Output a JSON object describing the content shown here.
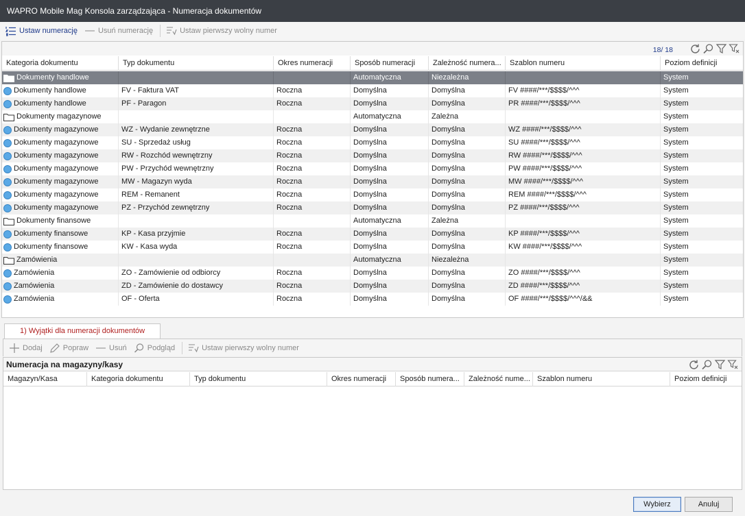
{
  "window": {
    "title": "WAPRO Mobile Mag Konsola zarządzająca - Numeracja dokumentów"
  },
  "toolbar": {
    "set_numbering": "Ustaw numerację",
    "remove_numbering": "Usuń numerację",
    "set_first_free": "Ustaw pierwszy wolny numer"
  },
  "grid": {
    "counter": "18/ 18",
    "columns": [
      "Kategoria dokumentu",
      "Typ dokumentu",
      "Okres numeracji",
      "Sposób numeracji",
      "Zależność numera...",
      "Szablon numeru",
      "Poziom definicji"
    ],
    "rows": [
      {
        "icon": "folder",
        "cat": "Dokumenty handlowe",
        "type": "",
        "period": "",
        "method": "Automatyczna",
        "dep": "Niezależna",
        "tpl": "",
        "level": "System"
      },
      {
        "icon": "dot",
        "cat": "Dokumenty handlowe",
        "type": "FV - Faktura VAT",
        "period": "Roczna",
        "method": "Domyślna",
        "dep": "Domyślna",
        "tpl": "FV ####/***/$$$$/^^^",
        "level": "System"
      },
      {
        "icon": "dot",
        "cat": "Dokumenty handlowe",
        "type": "PF - Paragon",
        "period": "Roczna",
        "method": "Domyślna",
        "dep": "Domyślna",
        "tpl": "PR ####/***/$$$$/^^^",
        "level": "System"
      },
      {
        "icon": "folder",
        "cat": "Dokumenty magazynowe",
        "type": "",
        "period": "",
        "method": "Automatyczna",
        "dep": "Zależna",
        "tpl": "",
        "level": "System"
      },
      {
        "icon": "dot",
        "cat": "Dokumenty magazynowe",
        "type": "WZ - Wydanie zewnętrzne",
        "period": "Roczna",
        "method": "Domyślna",
        "dep": "Domyślna",
        "tpl": "WZ ####/***/$$$$/^^^",
        "level": "System"
      },
      {
        "icon": "dot",
        "cat": "Dokumenty magazynowe",
        "type": "SU - Sprzedaż usług",
        "period": "Roczna",
        "method": "Domyślna",
        "dep": "Domyślna",
        "tpl": "SU ####/***/$$$$/^^^",
        "level": "System"
      },
      {
        "icon": "dot",
        "cat": "Dokumenty magazynowe",
        "type": "RW - Rozchód wewnętrzny",
        "period": "Roczna",
        "method": "Domyślna",
        "dep": "Domyślna",
        "tpl": "RW ####/***/$$$$/^^^",
        "level": "System"
      },
      {
        "icon": "dot",
        "cat": "Dokumenty magazynowe",
        "type": "PW - Przychód wewnętrzny",
        "period": "Roczna",
        "method": "Domyślna",
        "dep": "Domyślna",
        "tpl": "PW ####/***/$$$$/^^^",
        "level": "System"
      },
      {
        "icon": "dot",
        "cat": "Dokumenty magazynowe",
        "type": "MW - Magazyn wyda",
        "period": "Roczna",
        "method": "Domyślna",
        "dep": "Domyślna",
        "tpl": "MW ####/***/$$$$/^^^",
        "level": "System"
      },
      {
        "icon": "dot",
        "cat": "Dokumenty magazynowe",
        "type": "REM - Remanent",
        "period": "Roczna",
        "method": "Domyślna",
        "dep": "Domyślna",
        "tpl": "REM ####/***/$$$$/^^^",
        "level": "System"
      },
      {
        "icon": "dot",
        "cat": "Dokumenty magazynowe",
        "type": "PZ - Przychód zewnętrzny",
        "period": "Roczna",
        "method": "Domyślna",
        "dep": "Domyślna",
        "tpl": "PZ ####/***/$$$$/^^^",
        "level": "System"
      },
      {
        "icon": "folder",
        "cat": "Dokumenty finansowe",
        "type": "",
        "period": "",
        "method": "Automatyczna",
        "dep": "Zależna",
        "tpl": "",
        "level": "System"
      },
      {
        "icon": "dot",
        "cat": "Dokumenty finansowe",
        "type": "KP - Kasa przyjmie",
        "period": "Roczna",
        "method": "Domyślna",
        "dep": "Domyślna",
        "tpl": "KP ####/***/$$$$/^^^",
        "level": "System"
      },
      {
        "icon": "dot",
        "cat": "Dokumenty finansowe",
        "type": "KW - Kasa wyda",
        "period": "Roczna",
        "method": "Domyślna",
        "dep": "Domyślna",
        "tpl": "KW ####/***/$$$$/^^^",
        "level": "System"
      },
      {
        "icon": "folder",
        "cat": "Zamówienia",
        "type": "",
        "period": "",
        "method": "Automatyczna",
        "dep": "Niezależna",
        "tpl": "",
        "level": "System"
      },
      {
        "icon": "dot",
        "cat": "Zamówienia",
        "type": "ZO - Zamówienie od odbiorcy",
        "period": "Roczna",
        "method": "Domyślna",
        "dep": "Domyślna",
        "tpl": "ZO ####/***/$$$$/^^^",
        "level": "System"
      },
      {
        "icon": "dot",
        "cat": "Zamówienia",
        "type": "ZD - Zamówienie do dostawcy",
        "period": "Roczna",
        "method": "Domyślna",
        "dep": "Domyślna",
        "tpl": "ZD ####/***/$$$$/^^^",
        "level": "System"
      },
      {
        "icon": "dot",
        "cat": "Zamówienia",
        "type": "OF - Oferta",
        "period": "Roczna",
        "method": "Domyślna",
        "dep": "Domyślna",
        "tpl": "OF ####/***/$$$$/^^^/&&",
        "level": "System"
      }
    ]
  },
  "tab": {
    "label": "1) Wyjątki dla numeracji dokumentów"
  },
  "subtoolbar": {
    "add": "Dodaj",
    "edit": "Popraw",
    "remove": "Usuń",
    "preview": "Podgląd",
    "set_first_free": "Ustaw pierwszy wolny numer"
  },
  "subgrid": {
    "title": "Numeracja na magazyny/kasy",
    "columns": [
      "Magazyn/Kasa",
      "Kategoria dokumentu",
      "Typ dokumentu",
      "Okres numeracji",
      "Sposób numera...",
      "Zależność nume...",
      "Szablon numeru",
      "Poziom definicji"
    ]
  },
  "footer": {
    "choose": "Wybierz",
    "cancel": "Anuluj"
  },
  "colors": {
    "titlebar": "#3b3f45",
    "selected_row": "#7c8088",
    "accent": "#1f3a8a",
    "tab_text": "#b02020"
  },
  "icons": {
    "refresh": "refresh-icon",
    "search": "search-icon",
    "filter": "filter-icon",
    "clear_filter": "clear-filter-icon"
  }
}
